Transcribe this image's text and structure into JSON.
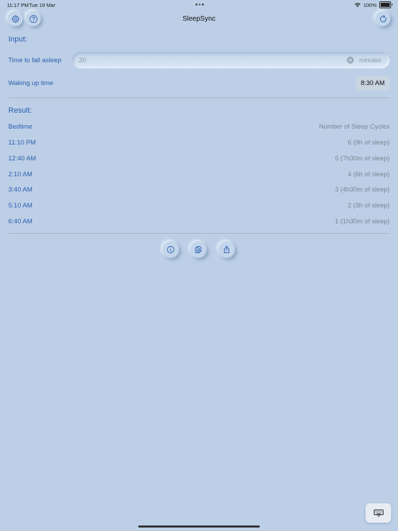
{
  "status_bar": {
    "time": "11:17 PM",
    "date": "Tue 19 Mar",
    "battery": "100%"
  },
  "header": {
    "title": "SleepSync",
    "left_icons": [
      "gear-icon",
      "help-icon"
    ],
    "right_icon": "refresh-icon"
  },
  "input_section": {
    "label": "Input:",
    "fall_asleep": {
      "label": "Time to fall asleep",
      "value": "20",
      "unit": "minutes"
    },
    "wake_up": {
      "label": "Waking up time",
      "value": "8:30 AM"
    }
  },
  "result_section": {
    "label": "Result:",
    "columns": [
      "Bedtime",
      "Number of Sleep Cycles"
    ],
    "rows": [
      {
        "time": "11:10 PM",
        "cycles": "6 (9h of sleep)"
      },
      {
        "time": "12:40 AM",
        "cycles": "5 (7h30m of sleep)"
      },
      {
        "time": "2:10 AM",
        "cycles": "4 (6h of sleep)"
      },
      {
        "time": "3:40 AM",
        "cycles": "3 (4h30m of sleep)"
      },
      {
        "time": "5:10 AM",
        "cycles": "2 (3h of sleep)"
      },
      {
        "time": "6:40 AM",
        "cycles": "1 (1h30m of sleep)"
      }
    ]
  },
  "actions": [
    "info-icon",
    "copy-icon",
    "share-icon"
  ],
  "colors": {
    "background": "#bccfe6",
    "accent": "#2b5fb0",
    "secondary_text": "#7b8796"
  }
}
